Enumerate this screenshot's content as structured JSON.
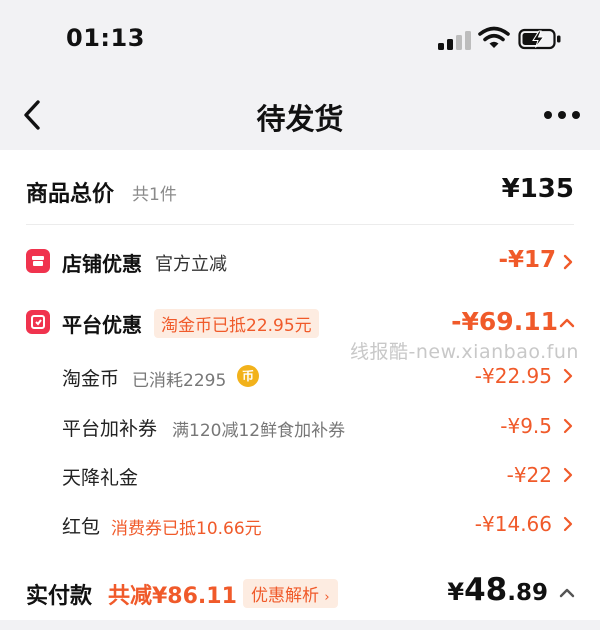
{
  "status_bar": {
    "time": "01:13"
  },
  "nav": {
    "title": "待发货"
  },
  "summary": {
    "label": "商品总价",
    "count": "共1件",
    "total": "¥135"
  },
  "shop_discount": {
    "label": "店铺优惠",
    "desc": "官方立减",
    "amount": "-¥17"
  },
  "platform_discount": {
    "label": "平台优惠",
    "tag": "淘金币已抵22.95元",
    "amount": "-¥69.11"
  },
  "sub_items": [
    {
      "label": "淘金币",
      "desc": "已消耗2295",
      "coin": "币",
      "amount": "-¥22.95"
    },
    {
      "label": "平台加补券",
      "desc": "满120减12鲜食加补券",
      "amount": "-¥9.5"
    },
    {
      "label": "天降礼金",
      "desc": "",
      "amount": "-¥22"
    },
    {
      "label": "红包",
      "desc": "消费券已抵10.66元",
      "amount": "-¥14.66"
    }
  ],
  "watermark": "线报酷-new.xianbao.fun",
  "payment": {
    "label": "实付款",
    "saved": "共减¥86.11",
    "analysis": "优惠解析",
    "currency": "¥",
    "integer": "48",
    "decimal": ".89"
  },
  "colors": {
    "accent": "#f05a2a",
    "shop_icon": "#f0334e",
    "pill_bg": "#fdece1"
  }
}
